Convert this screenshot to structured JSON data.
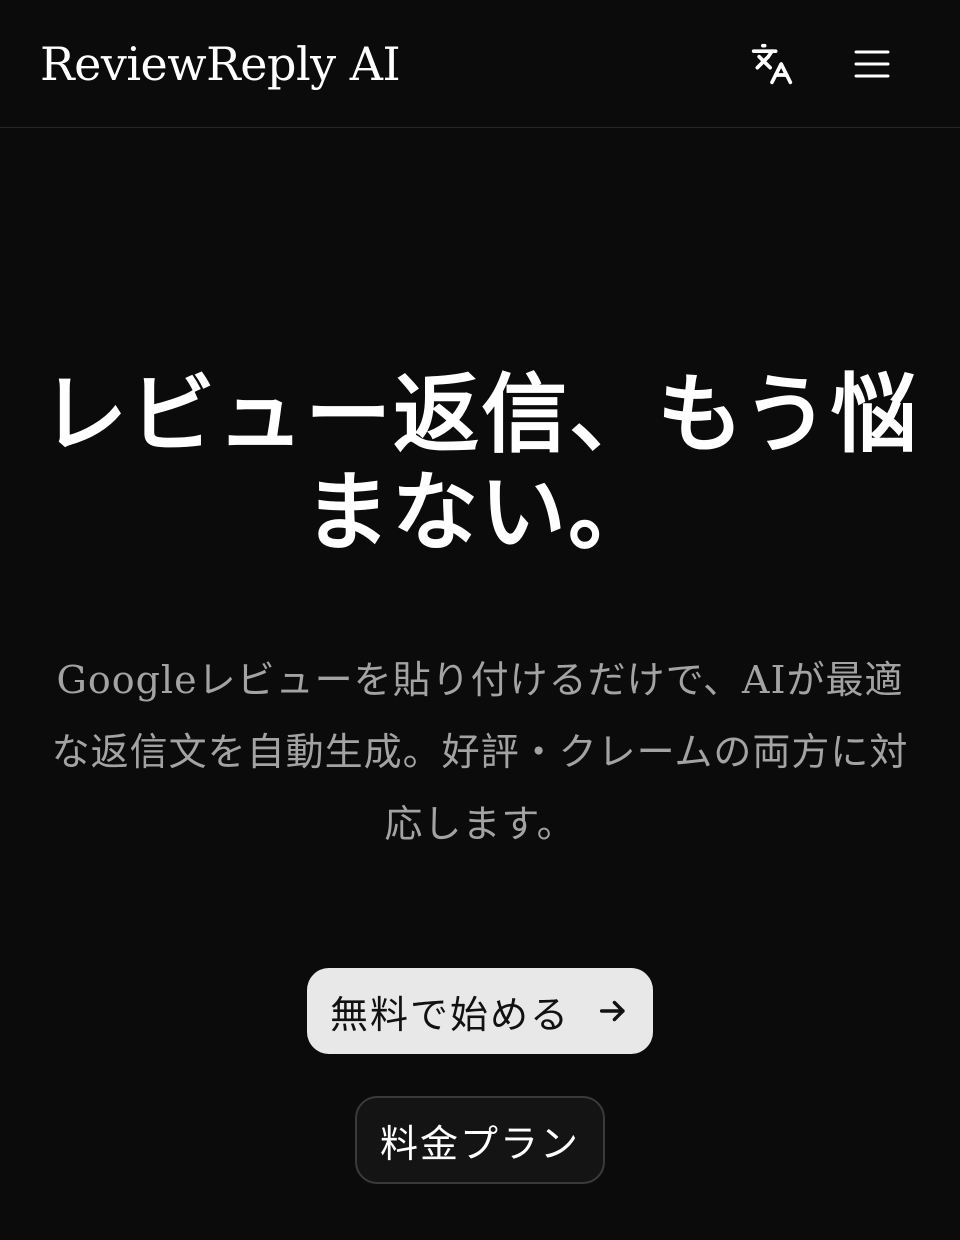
{
  "header": {
    "brand": "ReviewReply AI",
    "translate_icon": "translate-icon",
    "menu_icon": "hamburger-menu-icon"
  },
  "hero": {
    "title_line1": "レビュー返信、もう悩",
    "title_line2": "まない。",
    "subtitle": "Googleレビューを貼り付けるだけで、AIが最適な返信文を自動生成。好評・クレームの両方に対応します。"
  },
  "buttons": {
    "primary_label": "無料で始める",
    "primary_icon": "arrow-right-icon",
    "secondary_label": "料金プラン"
  },
  "colors": {
    "background": "#0b0b0b",
    "text": "#ffffff",
    "muted_text": "#a3a3a3",
    "primary_button_bg": "#e8e8e8",
    "secondary_button_border": "#3a3a3a"
  }
}
